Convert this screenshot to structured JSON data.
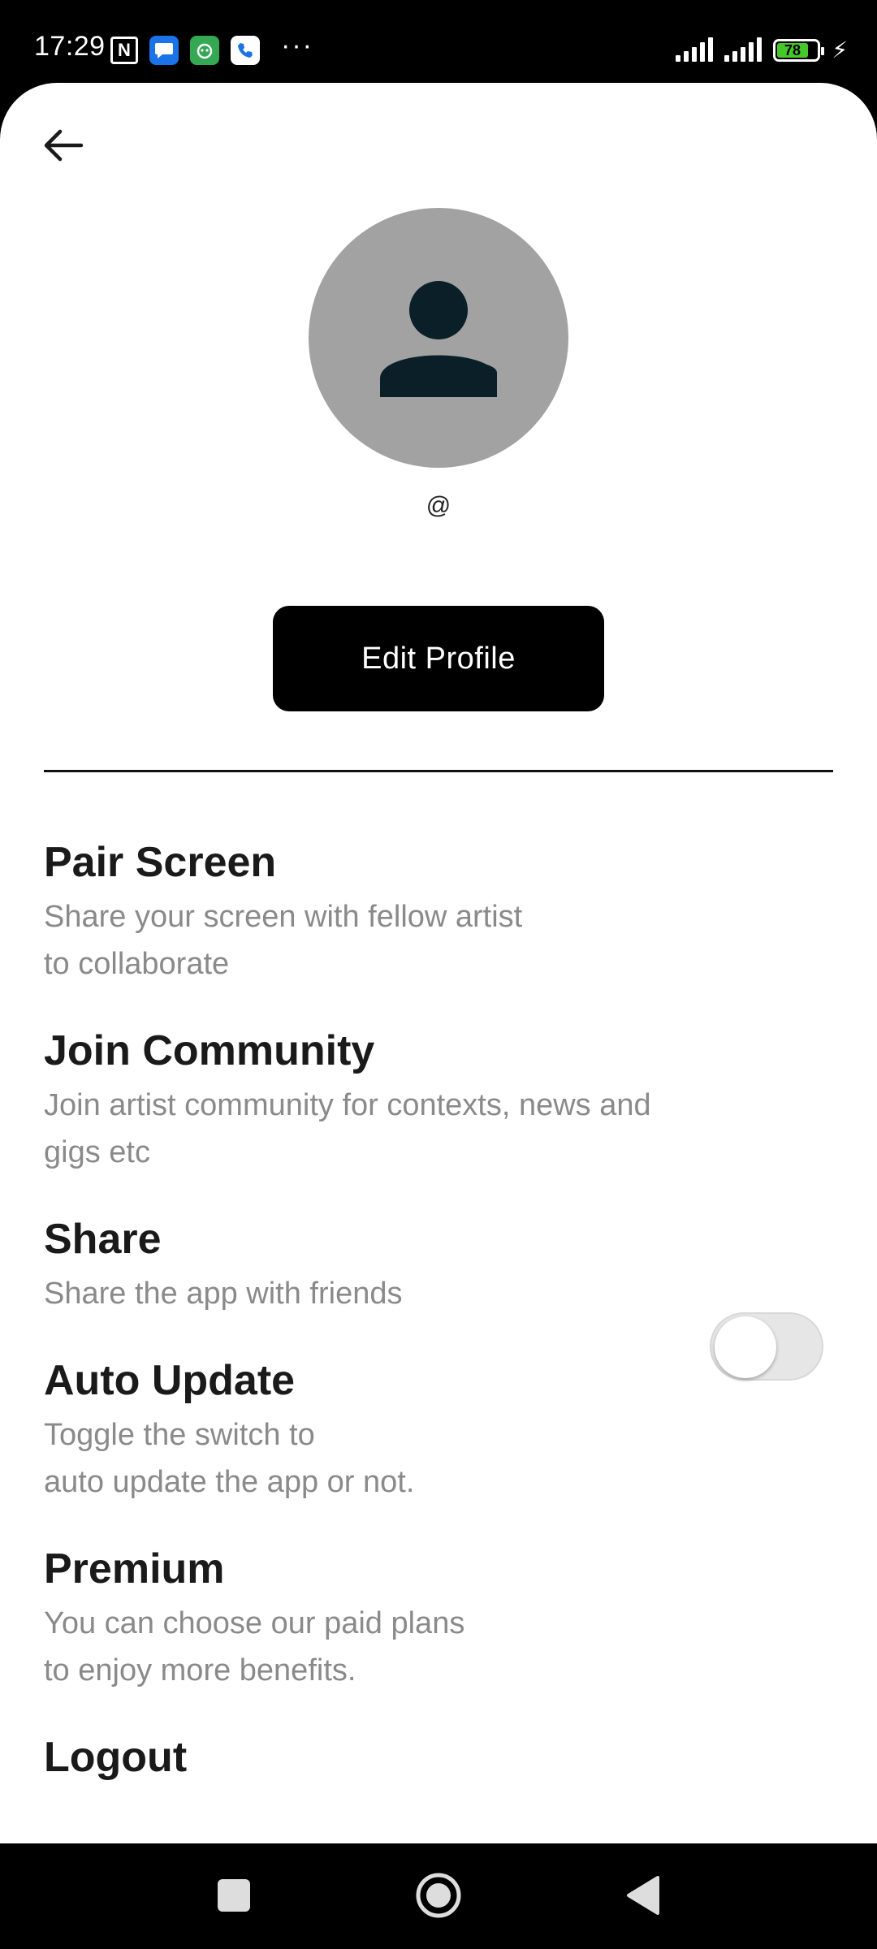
{
  "status_bar": {
    "time": "17:29",
    "battery_level": "78",
    "icons": [
      "nfc-icon",
      "messages-icon",
      "bot-app-icon",
      "phone-icon",
      "more-dots-icon",
      "signal-icon",
      "signal-icon",
      "battery-icon",
      "charging-bolt-icon"
    ],
    "more_dots": "···",
    "bolt": "⚡"
  },
  "header": {
    "back_icon": "back-arrow-icon"
  },
  "profile": {
    "avatar_icon": "person-icon",
    "handle": "@",
    "edit_button_label": "Edit Profile"
  },
  "menu": {
    "items": [
      {
        "title": "Pair Screen",
        "description": "Share your screen with fellow artist\nto collaborate"
      },
      {
        "title": "Join Community",
        "description": "Join artist community for contexts, news and\ngigs etc"
      },
      {
        "title": "Share",
        "description": "Share the app  with friends"
      },
      {
        "title": "Auto Update",
        "description": "Toggle the switch to\nauto update the app or not.",
        "toggle_on": false
      },
      {
        "title": "Premium",
        "description": "You can choose our paid plans\nto enjoy more benefits."
      },
      {
        "title": "Logout"
      }
    ]
  },
  "colors": {
    "avatar_bg": "#a2a2a2",
    "avatar_figure": "#0b1f28",
    "button_bg": "#000000",
    "desc_text": "#8a8a8a"
  }
}
